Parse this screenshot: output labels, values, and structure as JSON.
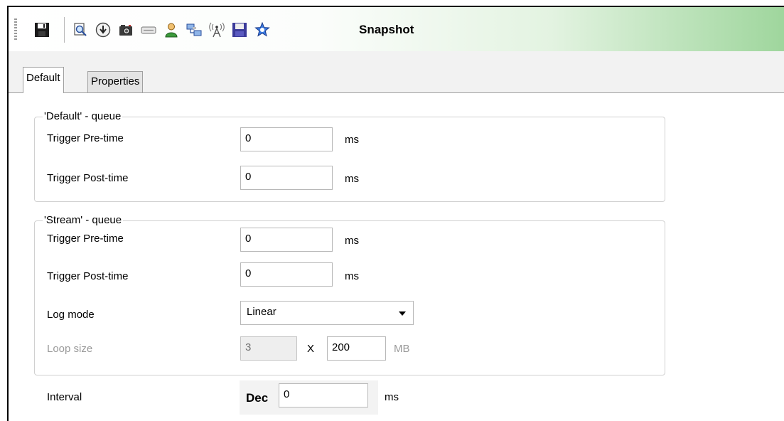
{
  "toolbar": {
    "title": "Snapshot",
    "icons": [
      "save-icon",
      "print-preview-icon",
      "download-icon",
      "camera-icon",
      "card-icon",
      "user-icon",
      "network-icon",
      "antenna-icon",
      "save-disk-icon",
      "gear-star-icon"
    ],
    "accent": "#9fd69d"
  },
  "tabs": {
    "default": "Default",
    "properties": "Properties"
  },
  "default_queue": {
    "legend": "'Default' - queue",
    "pre_label": "Trigger Pre-time",
    "pre_value": "0",
    "pre_unit": "ms",
    "post_label": "Trigger Post-time",
    "post_value": "0",
    "post_unit": "ms"
  },
  "stream_queue": {
    "legend": "'Stream' - queue",
    "pre_label": "Trigger Pre-time",
    "pre_value": "0",
    "pre_unit": "ms",
    "post_label": "Trigger Post-time",
    "post_value": "0",
    "post_unit": "ms",
    "log_mode_label": "Log mode",
    "log_mode_value": "Linear",
    "loop_size_label": "Loop size",
    "loop_count": "3",
    "loop_x": "X",
    "loop_size": "200",
    "loop_unit": "MB"
  },
  "interval": {
    "label": "Interval",
    "format": "Dec",
    "value": "0",
    "unit": "ms"
  }
}
